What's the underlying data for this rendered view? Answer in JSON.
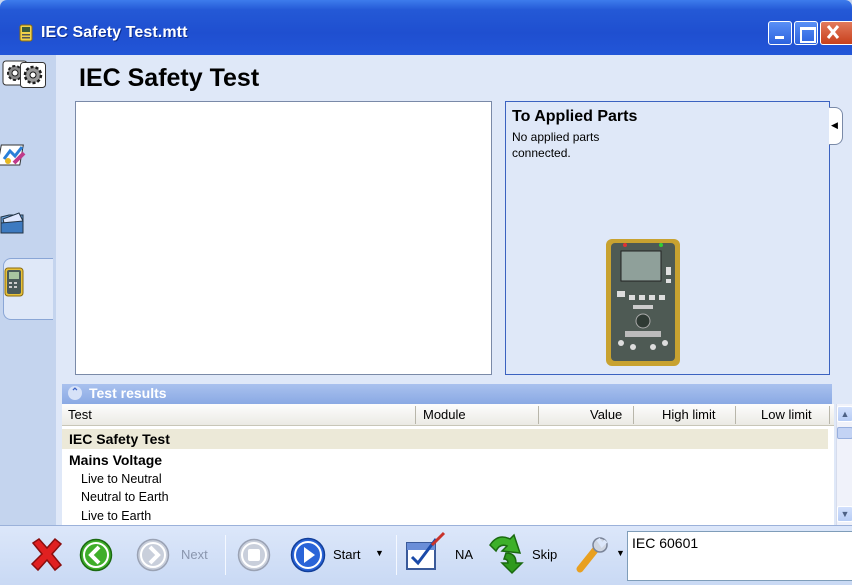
{
  "window": {
    "title": "IEC Safety Test.mtt",
    "controls": [
      "minimize-icon",
      "maximize-icon",
      "close-icon"
    ]
  },
  "side_tabs": [
    {
      "icon": "gear-icon",
      "active": false
    },
    {
      "icon": "report-edit-icon",
      "active": false
    },
    {
      "icon": "folder-icon",
      "active": false
    },
    {
      "icon": "analyzer-device-icon",
      "active": true
    }
  ],
  "main": {
    "heading": "IEC Safety Test",
    "applied_parts": {
      "title": "To Applied Parts",
      "message": "No applied parts connected."
    }
  },
  "results": {
    "header": "Test results",
    "columns": [
      "Test",
      "Module",
      "Value",
      "High limit",
      "Low limit"
    ],
    "rows": [
      {
        "label": "IEC Safety Test",
        "level": 0,
        "selected": true
      },
      {
        "label": "Mains Voltage",
        "level": 0,
        "selected": false
      },
      {
        "label": "Live to Neutral",
        "level": 1,
        "selected": false
      },
      {
        "label": "Neutral to Earth",
        "level": 1,
        "selected": false
      },
      {
        "label": "Live to Earth",
        "level": 1,
        "selected": false
      }
    ]
  },
  "toolbar": {
    "cancel_icon": "cancel-x-icon",
    "back_icon": "back-arrow-icon",
    "next_label": "Next",
    "stop_icon": "stop-icon",
    "start_label": "Start",
    "na_label": "NA",
    "skip_label": "Skip",
    "settings_icon": "wrench-icon",
    "standard_value": "IEC 60601"
  },
  "colors": {
    "titlebar": "#2459d6",
    "panel": "#dfe8f8",
    "results_header": "#8aa9e4",
    "selected_row": "#ece9d8"
  }
}
